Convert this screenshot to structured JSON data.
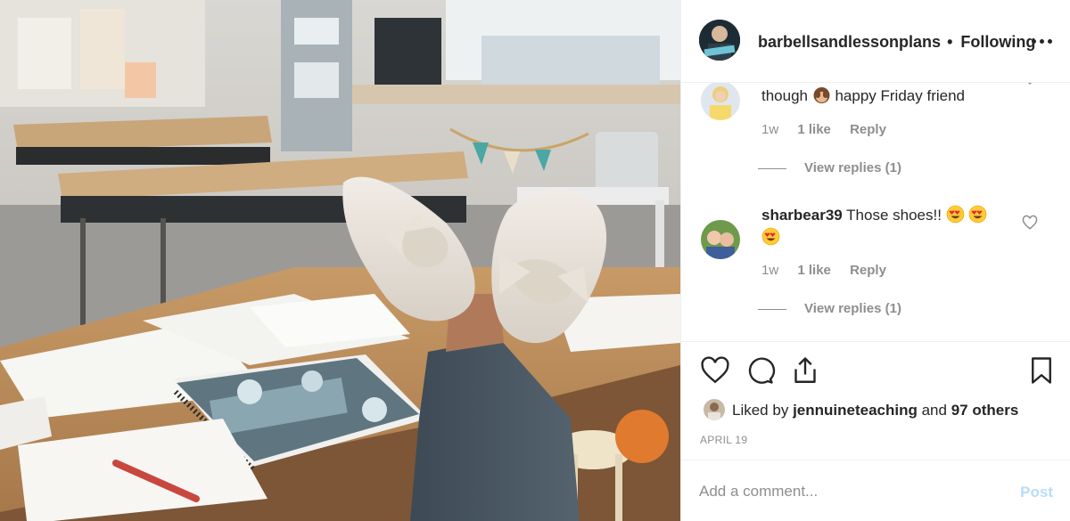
{
  "post": {
    "image_alt": "Teacher with feet up on a classroom desk wearing white bow sneakers"
  },
  "header": {
    "username": "barbellsandlessonplans",
    "separator": "•",
    "follow_status": "Following",
    "more_icon": "more-horizontal-icon"
  },
  "comments": [
    {
      "username": "",
      "text": "though",
      "emoji": "see-no-evil-monkey",
      "text_after": "happy Friday friend",
      "age": "1w",
      "likes": "1 like",
      "reply_label": "Reply",
      "view_replies": "View replies (1)"
    },
    {
      "username": "sharbear39",
      "text": "Those shoes!!",
      "emoji": "heart-eyes",
      "age": "1w",
      "likes": "1 like",
      "reply_label": "Reply",
      "view_replies": "View replies (1)"
    }
  ],
  "actions": {
    "like_icon": "heart-icon",
    "comment_icon": "comment-icon",
    "share_icon": "share-icon",
    "save_icon": "bookmark-icon"
  },
  "likes": {
    "prefix": "Liked by",
    "user": "jennuineteaching",
    "conjunction": "and",
    "others": "97 others"
  },
  "date": "APRIL 19",
  "composer": {
    "placeholder": "Add a comment...",
    "post_label": "Post"
  },
  "colors": {
    "text": "#262626",
    "muted": "#8e8e8e",
    "border": "#efefef",
    "post_disabled": "#b9dcf9"
  }
}
